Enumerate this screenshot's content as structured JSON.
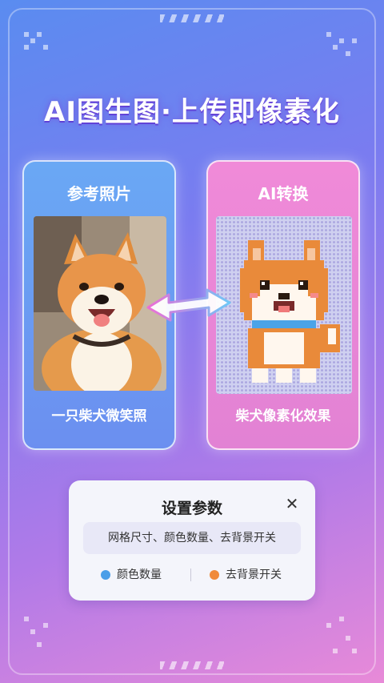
{
  "headline": "AI图生图·上传即像素化",
  "left_card": {
    "label": "参考照片",
    "caption": "一只柴犬微笑照"
  },
  "right_card": {
    "label": "AI转换",
    "caption": "柴犬像素化效果"
  },
  "settings": {
    "title": "设置参数",
    "description": "网格尺寸、颜色数量、去背景开关",
    "close_icon": "close-icon",
    "legend": [
      {
        "label": "颜色数量",
        "color": "#4a9ee8"
      },
      {
        "label": "去背景开关",
        "color": "#f08a3a"
      }
    ]
  },
  "colors": {
    "accent_blue": "#4a9ee8",
    "accent_orange": "#f08a3a",
    "shiba_orange": "#e98a3a",
    "collar_blue": "#4aa3e8"
  }
}
